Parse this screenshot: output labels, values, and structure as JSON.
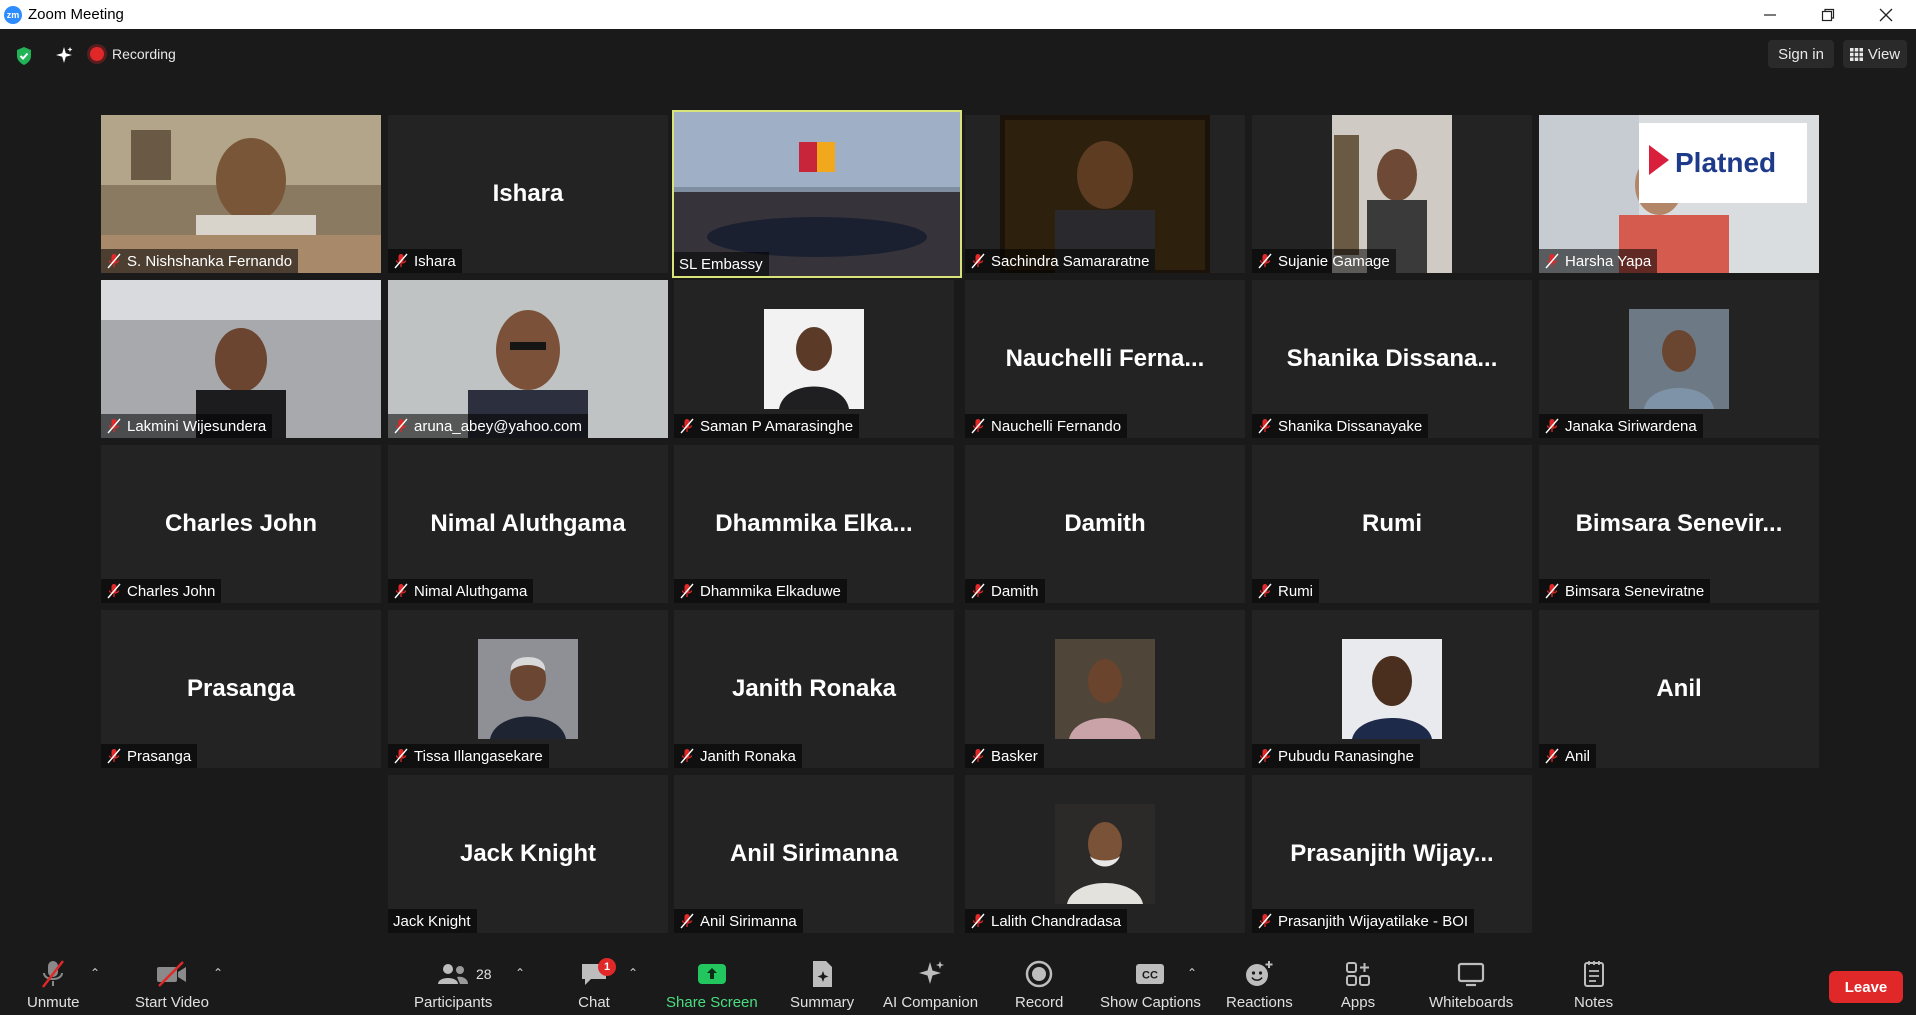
{
  "window": {
    "app_icon_text": "zm",
    "title": "Zoom Meeting"
  },
  "topbar": {
    "recording_label": "Recording",
    "signin_label": "Sign in",
    "view_label": "View"
  },
  "tiles": [
    {
      "big": "",
      "caption": "S. Nishshanka Fernando",
      "muted": true,
      "video": "photo"
    },
    {
      "big": "Ishara",
      "caption": "Ishara",
      "muted": true,
      "video": "none"
    },
    {
      "big": "",
      "caption": "SL Embassy",
      "muted": false,
      "video": "photo",
      "active": true
    },
    {
      "big": "",
      "caption": "Sachindra Samararatne",
      "muted": true,
      "video": "photo"
    },
    {
      "big": "",
      "caption": "Sujanie Gamage",
      "muted": true,
      "video": "photo"
    },
    {
      "big": "",
      "caption": "Harsha Yapa",
      "muted": true,
      "video": "photo",
      "logo_text": "Platned"
    },
    {
      "big": "",
      "caption": "Lakmini Wijesundera",
      "muted": true,
      "video": "photo"
    },
    {
      "big": "",
      "caption": "aruna_abey@yahoo.com",
      "muted": true,
      "video": "photo"
    },
    {
      "big": "",
      "caption": "Saman P Amarasinghe",
      "muted": true,
      "video": "thumb"
    },
    {
      "big": "Nauchelli  Ferna...",
      "caption": "Nauchelli Fernando",
      "muted": true,
      "video": "none"
    },
    {
      "big": "Shanika  Dissana...",
      "caption": "Shanika Dissanayake",
      "muted": true,
      "video": "none"
    },
    {
      "big": "",
      "caption": "Janaka Siriwardena",
      "muted": true,
      "video": "thumb"
    },
    {
      "big": "Charles John",
      "caption": "Charles John",
      "muted": true,
      "video": "none"
    },
    {
      "big": "Nimal Aluthgama",
      "caption": "Nimal Aluthgama",
      "muted": true,
      "video": "none"
    },
    {
      "big": "Dhammika  Elka...",
      "caption": "Dhammika Elkaduwe",
      "muted": true,
      "video": "none"
    },
    {
      "big": "Damith",
      "caption": "Damith",
      "muted": true,
      "video": "none"
    },
    {
      "big": "Rumi",
      "caption": "Rumi",
      "muted": true,
      "video": "none"
    },
    {
      "big": "Bimsara  Senevir...",
      "caption": "Bimsara Seneviratne",
      "muted": true,
      "video": "none"
    },
    {
      "big": "Prasanga",
      "caption": "Prasanga",
      "muted": true,
      "video": "none"
    },
    {
      "big": "",
      "caption": "Tissa Illangasekare",
      "muted": true,
      "video": "thumb"
    },
    {
      "big": "Janith Ronaka",
      "caption": "Janith Ronaka",
      "muted": true,
      "video": "none"
    },
    {
      "big": "",
      "caption": "Basker",
      "muted": true,
      "video": "thumb"
    },
    {
      "big": "",
      "caption": "Pubudu Ranasinghe",
      "muted": true,
      "video": "thumb"
    },
    {
      "big": "Anil",
      "caption": "Anil",
      "muted": true,
      "video": "none"
    },
    {
      "big": "Jack Knight",
      "caption": "Jack Knight",
      "muted": false,
      "video": "none"
    },
    {
      "big": "Anil Sirimanna",
      "caption": "Anil Sirimanna",
      "muted": true,
      "video": "none"
    },
    {
      "big": "",
      "caption": "Lalith Chandradasa",
      "muted": true,
      "video": "thumb"
    },
    {
      "big": "Prasanjith  Wijay...",
      "caption": "Prasanjith Wijayatilake - BOI",
      "muted": true,
      "video": "none"
    }
  ],
  "toolbar": {
    "unmute": "Unmute",
    "start_video": "Start Video",
    "participants": "Participants",
    "participants_count": "28",
    "chat": "Chat",
    "chat_badge": "1",
    "share_screen": "Share Screen",
    "summary": "Summary",
    "ai_companion": "AI Companion",
    "record": "Record",
    "show_captions": "Show Captions",
    "reactions": "Reactions",
    "apps": "Apps",
    "whiteboards": "Whiteboards",
    "notes": "Notes",
    "leave": "Leave"
  },
  "colors": {
    "active_speaker": "#d8e37a",
    "leave": "#e02828",
    "share_green": "#22c55e",
    "mute_red": "#e02828"
  }
}
